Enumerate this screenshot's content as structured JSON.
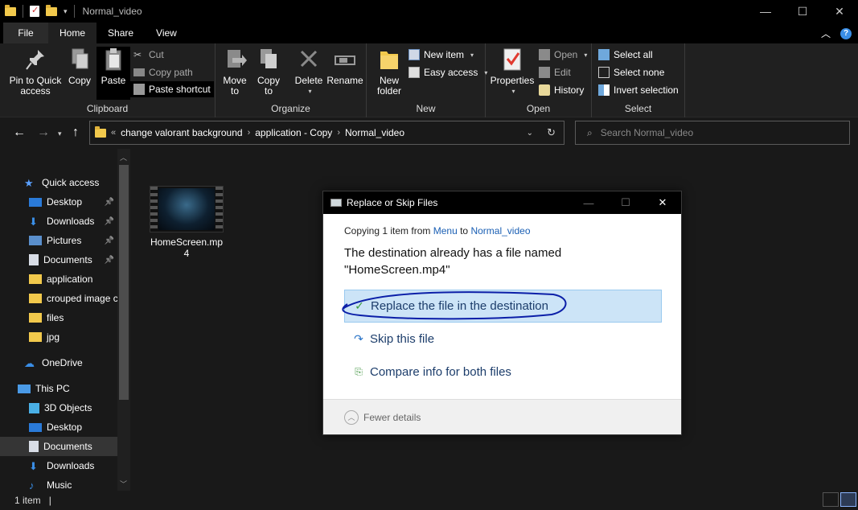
{
  "window": {
    "title": "Normal_video",
    "controls": {
      "minimize": "—",
      "maximize": "☐",
      "close": "✕"
    }
  },
  "tabs": [
    "File",
    "Home",
    "Share",
    "View"
  ],
  "ribbon": {
    "clipboard": {
      "label": "Clipboard",
      "pin": [
        "Pin to Quick",
        "access"
      ],
      "copy": "Copy",
      "paste": "Paste",
      "cut": "Cut",
      "copy_path": "Copy path",
      "paste_shortcut": "Paste shortcut"
    },
    "organize": {
      "label": "Organize",
      "move_to": [
        "Move",
        "to"
      ],
      "copy_to": [
        "Copy",
        "to"
      ],
      "delete": "Delete",
      "rename": "Rename"
    },
    "new": {
      "label": "New",
      "new_folder": [
        "New",
        "folder"
      ],
      "new_item": "New item",
      "easy_access": "Easy access"
    },
    "open": {
      "label": "Open",
      "properties": "Properties",
      "open": "Open",
      "edit": "Edit",
      "history": "History"
    },
    "select": {
      "label": "Select",
      "select_all": "Select all",
      "select_none": "Select none",
      "invert": "Invert selection"
    }
  },
  "address": {
    "crumbs": [
      "change valorant background",
      "application - Copy",
      "Normal_video"
    ],
    "search_placeholder": "Search Normal_video"
  },
  "sidebar": {
    "items": [
      {
        "label": "Quick access",
        "icon": "star-icon",
        "pinned": false
      },
      {
        "label": "Desktop",
        "icon": "desktop-icon",
        "pinned": true
      },
      {
        "label": "Downloads",
        "icon": "download-icon",
        "pinned": true
      },
      {
        "label": "Pictures",
        "icon": "pictures-icon",
        "pinned": true
      },
      {
        "label": "Documents",
        "icon": "documents-icon",
        "pinned": true
      },
      {
        "label": "application",
        "icon": "folder-icon",
        "pinned": false
      },
      {
        "label": "crouped image c",
        "icon": "folder-icon",
        "pinned": false
      },
      {
        "label": "files",
        "icon": "folder-icon",
        "pinned": false
      },
      {
        "label": "jpg",
        "icon": "folder-icon",
        "pinned": false
      },
      {
        "label": "OneDrive",
        "icon": "cloud-icon",
        "pinned": false
      },
      {
        "label": "This PC",
        "icon": "pc-icon",
        "pinned": false
      },
      {
        "label": "3D Objects",
        "icon": "cube-icon",
        "pinned": false
      },
      {
        "label": "Desktop",
        "icon": "desktop-icon",
        "pinned": false
      },
      {
        "label": "Documents",
        "icon": "documents-icon",
        "pinned": false
      },
      {
        "label": "Downloads",
        "icon": "download-icon",
        "pinned": false
      },
      {
        "label": "Music",
        "icon": "music-icon",
        "pinned": false
      }
    ]
  },
  "content": {
    "file_name": "HomeScreen.mp4"
  },
  "status": {
    "count": "1 item"
  },
  "dialog": {
    "title": "Replace or Skip Files",
    "copying_prefix": "Copying 1 item from",
    "from": "Menu",
    "to_word": "to",
    "to": "Normal_video",
    "message_line1": "The destination already has a file named",
    "message_line2": "\"HomeScreen.mp4\"",
    "options": [
      {
        "label": "Replace the file in the destination",
        "icon": "check-icon"
      },
      {
        "label": "Skip this file",
        "icon": "skip-arrow-icon"
      },
      {
        "label": "Compare info for both files",
        "icon": "compare-icon"
      }
    ],
    "fewer_details": "Fewer details"
  },
  "colors": {
    "accent": "#1a5fb4",
    "highlight": "#cce4f7",
    "folder": "#f2c94c",
    "ink": "#0b1fa8"
  }
}
